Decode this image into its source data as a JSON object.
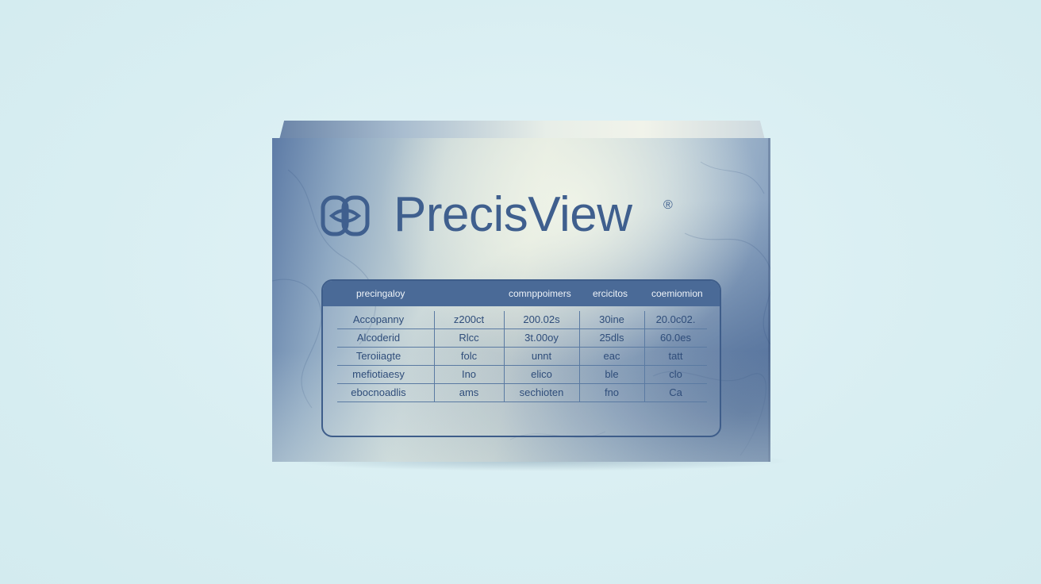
{
  "brand": {
    "name": "PrecisView",
    "registered_mark": "®",
    "logo_icon": "interlocking-rings-logo",
    "color": "#3f5f8e"
  },
  "table": {
    "headers": [
      "precingaloy",
      "comnppoimers",
      "ercicitos",
      "coemiomion"
    ],
    "rows": [
      [
        "Accopanny",
        "z200ct",
        "200.02s",
        "30ine",
        "20.0c02."
      ],
      [
        "Alcoderid",
        "Rlcc",
        "3t.00oy",
        "25dls",
        "60.0es"
      ],
      [
        "Teroiiagte",
        "folc",
        "unnt",
        "eac",
        "tatt"
      ],
      [
        "mefiotiaesy",
        "Ino",
        "elico",
        "ble",
        "clo"
      ],
      [
        "ebocnoadlis",
        "ams",
        "sechioten",
        "fno",
        "Ca"
      ]
    ],
    "header_bg": "#4a6a97",
    "border_color": "#3e5d8a"
  }
}
